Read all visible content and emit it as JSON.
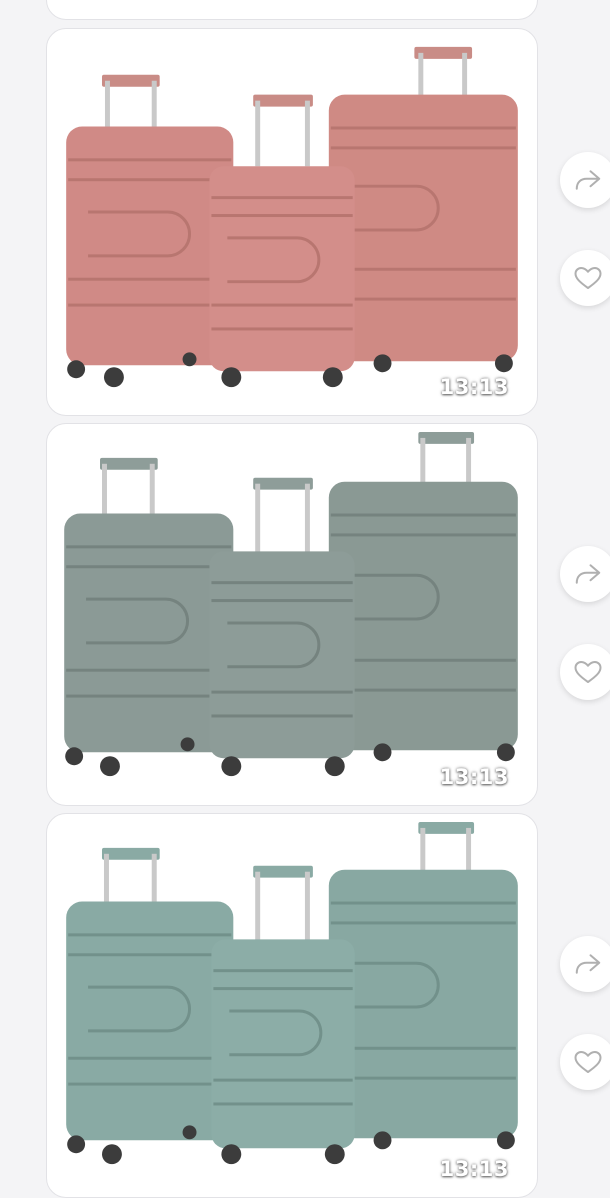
{
  "posts": [
    {
      "timestamp": "",
      "color": "partial"
    },
    {
      "timestamp": "13:13",
      "color": "dusty-rose",
      "hex": "#d08a86"
    },
    {
      "timestamp": "13:13",
      "color": "sage-gray",
      "hex": "#8a9994"
    },
    {
      "timestamp": "13:13",
      "color": "mint-teal",
      "hex": "#89aaa4"
    }
  ],
  "actions": {
    "share_icon": "share-arrow-icon",
    "like_icon": "heart-outline-icon"
  }
}
